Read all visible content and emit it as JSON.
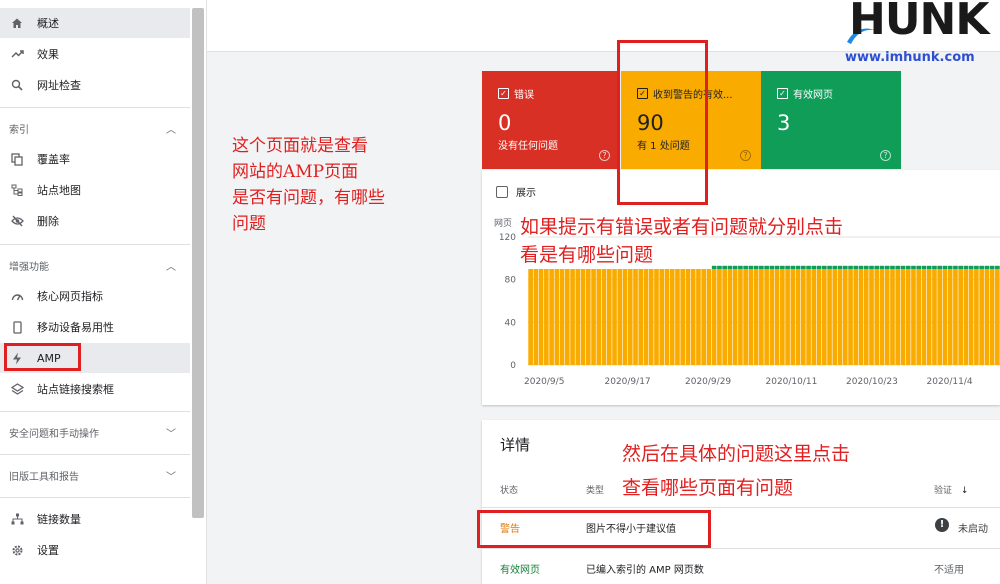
{
  "sidebar": {
    "items_top": [
      {
        "label": "概述",
        "icon": "home-icon",
        "active": true
      },
      {
        "label": "效果",
        "icon": "trending-icon"
      },
      {
        "label": "网址检查",
        "icon": "search-icon"
      }
    ],
    "index_section": "索引",
    "index_items": [
      {
        "label": "覆盖率",
        "icon": "copy-icon"
      },
      {
        "label": "站点地图",
        "icon": "sitemap-icon"
      },
      {
        "label": "删除",
        "icon": "eye-off-icon"
      }
    ],
    "enhancements_section": "增强功能",
    "enhancement_items": [
      {
        "label": "核心网页指标",
        "icon": "gauge-icon"
      },
      {
        "label": "移动设备易用性",
        "icon": "phone-icon"
      },
      {
        "label": "AMP",
        "icon": "bolt-icon",
        "active": true
      },
      {
        "label": "站点链接搜索框",
        "icon": "layers-icon"
      }
    ],
    "security_section": "安全问题和手动操作",
    "legacy_section": "旧版工具和报告",
    "bottom_items": [
      {
        "label": "链接数量",
        "icon": "network-icon"
      },
      {
        "label": "设置",
        "icon": "gear-icon"
      }
    ]
  },
  "brand": {
    "name": "HUNK",
    "url": "www.imhunk.com"
  },
  "cards": {
    "error": {
      "label": "错误",
      "value": "0",
      "sub": "没有任何问题",
      "color": "#d93025"
    },
    "warning": {
      "label": "收到警告的有效...",
      "value": "90",
      "sub": "有 1 处问题",
      "color": "#f9ab00"
    },
    "valid": {
      "label": "有效网页",
      "value": "3",
      "sub": "",
      "color": "#0f9d58"
    }
  },
  "chart": {
    "show_label": "展示"
  },
  "chart_data": {
    "type": "bar",
    "ylabel": "网页",
    "ylim": [
      0,
      120
    ],
    "yticks": [
      0,
      40,
      80,
      120
    ],
    "xtick_labels": [
      "2020/9/5",
      "2020/9/17",
      "2020/9/29",
      "2020/10/11",
      "2020/10/23",
      "2020/11/4"
    ],
    "series": [
      {
        "name": "收到警告的有效网页",
        "color": "#f9ab00",
        "base_value": 90,
        "days": 90
      },
      {
        "name": "有效网页",
        "color": "#0f9d58",
        "values_note_days_with_green_from_index": 35,
        "value": 3
      }
    ],
    "grid": true
  },
  "details": {
    "title": "详情",
    "columns": {
      "status": "状态",
      "type": "类型",
      "validation": "验证"
    },
    "rows": [
      {
        "status": "警告",
        "status_color": "#e37400",
        "type": "图片不得小于建议值",
        "validation": "未启动",
        "has_alert_icon": true
      },
      {
        "status": "有效网页",
        "status_color": "#188038",
        "type": "已编入索引的 AMP 网页数",
        "validation": "不适用",
        "has_alert_icon": false
      }
    ]
  },
  "annotations": {
    "left_note": [
      "这个页面就是查看",
      "网站的AMP页面",
      "是否有问题，有哪些",
      "问题"
    ],
    "chart_note": [
      "如果提示有错误或者有问题就分别点击",
      "看是有哪些问题"
    ],
    "details_note": [
      "然后在具体的问题这里点击",
      "查看哪些页面有问题"
    ]
  }
}
